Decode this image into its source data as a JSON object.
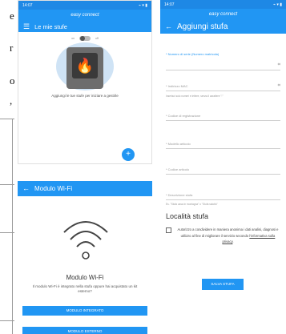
{
  "document": {
    "fragments": [
      "e",
      "r",
      "o",
      ","
    ]
  },
  "screen_list": {
    "status_time": "14:07",
    "status_icons": "⌁ ▾ ▮",
    "logo": "easy connect",
    "title": "Le mie stufe",
    "toggle_left": "on",
    "toggle_right": "off",
    "empty_text": "Aggiungi le tue stufe per iniziare a gestirle",
    "fab": "+"
  },
  "screen_add": {
    "status_time": "14:07",
    "logo": "easy connect",
    "title": "Aggiungi stufa",
    "fields": [
      "* Numero di serie (Numero matricola)",
      "* Indirizzo MAC",
      "* Codice di registrazione",
      "* Modello articolo",
      "* Codice articolo",
      "* Descrizione stufa"
    ],
    "mac_hint": "Inserisci solo numeri e lettere, senza il carattere \":\"",
    "description_hint": "Es. \"Stufa casa in montagna\" o \"Stufa salotto\"",
    "location_title": "Località stufa",
    "consent_text": "Autorizzo a condividere in maniera anonima i dati analisi, diagnosi e utilizzo al fine di migliorare il servizio secondo",
    "consent_link": "l'informativa sulla privacy",
    "save_button": "SALVA STUFA"
  },
  "screen_wifi": {
    "title": "Modulo Wi-Fi",
    "heading": "Modulo Wi-Fi",
    "description": "Il modulo Wi-Fi è integrato nella stufa oppure hai acquistato un kit esterno?",
    "integrated_button": "MODULO INTEGRATO",
    "external_button": "MODULO ESTERNO"
  },
  "colors": {
    "primary": "#2196f3",
    "flame": "#ff5a1f"
  }
}
